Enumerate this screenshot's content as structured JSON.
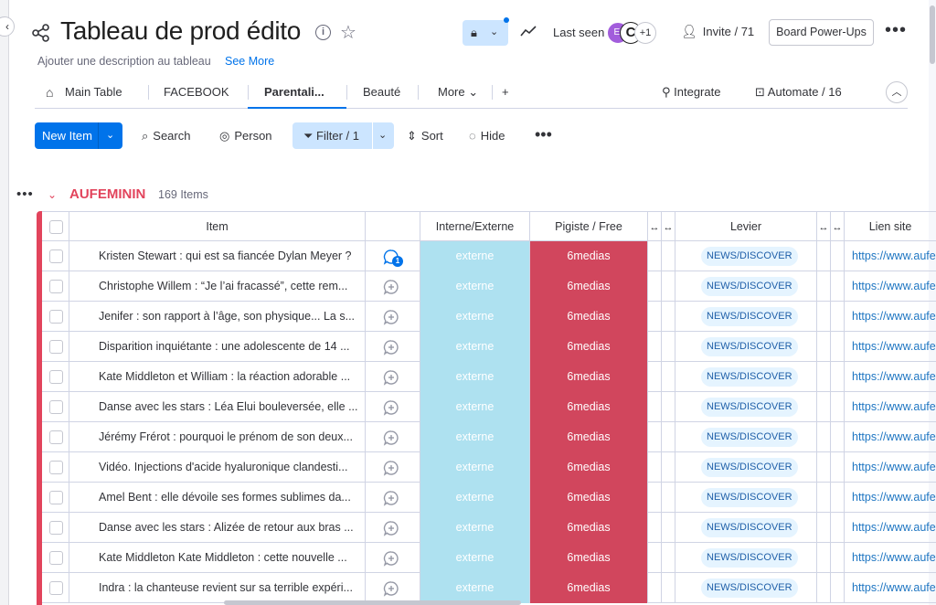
{
  "header": {
    "board_title": "Tableau de prod édito",
    "description_placeholder": "Ajouter une description au tableau",
    "see_more": "See More",
    "last_seen_label": "Last seen",
    "avatars": [
      {
        "initials": "El"
      },
      {
        "initials": "C"
      },
      {
        "initials": "+1"
      }
    ],
    "invite_label": "Invite / 71",
    "power_ups_label": "Board Power-Ups",
    "more_label": "•••",
    "accent_color": "#0073ea"
  },
  "views": {
    "tabs": [
      {
        "label": "Main Table"
      },
      {
        "label": "FACEBOOK"
      },
      {
        "label": "Parentali..."
      },
      {
        "label": "Beauté"
      }
    ],
    "more_label": "More",
    "add_label": "+",
    "integrate_label": "Integrate",
    "automate_label": "Automate / 16"
  },
  "toolbar": {
    "new_item_label": "New Item",
    "search_label": "Search",
    "person_label": "Person",
    "filter_label": "Filter / 1",
    "sort_label": "Sort",
    "hide_label": "Hide",
    "more_label": "•••"
  },
  "group": {
    "title": "AUFEMININ",
    "count": "169 Items",
    "color": "#e2445c"
  },
  "table": {
    "columns": {
      "item": "Item",
      "interne_externe": "Interne/Externe",
      "pigiste_free": "Pigiste / Free",
      "levier": "Levier",
      "lien_site": "Lien site"
    },
    "rows": [
      {
        "item": "Kristen Stewart : qui est sa fiancée Dylan Meyer ?",
        "updates": "1",
        "ie": "externe",
        "pigiste": "6medias",
        "levier": "NEWS/DISCOVER",
        "lien": "https://www.aufe"
      },
      {
        "item": "Christophe Willem : “Je l’ai fracassé”, cette rem...",
        "updates": "",
        "ie": "externe",
        "pigiste": "6medias",
        "levier": "NEWS/DISCOVER",
        "lien": "https://www.aufe"
      },
      {
        "item": "Jenifer : son rapport à l’âge, son physique... La s...",
        "updates": "",
        "ie": "externe",
        "pigiste": "6medias",
        "levier": "NEWS/DISCOVER",
        "lien": "https://www.aufe"
      },
      {
        "item": "Disparition inquiétante : une adolescente de 14 ...",
        "updates": "",
        "ie": "externe",
        "pigiste": "6medias",
        "levier": "NEWS/DISCOVER",
        "lien": "https://www.aufe"
      },
      {
        "item": "Kate Middleton et William : la réaction adorable ...",
        "updates": "",
        "ie": "externe",
        "pigiste": "6medias",
        "levier": "NEWS/DISCOVER",
        "lien": "https://www.aufe"
      },
      {
        "item": "Danse avec les stars : Léa Elui bouleversée, elle ...",
        "updates": "",
        "ie": "externe",
        "pigiste": "6medias",
        "levier": "NEWS/DISCOVER",
        "lien": "https://www.aufe"
      },
      {
        "item": "Jérémy Frérot : pourquoi le prénom de son deux...",
        "updates": "",
        "ie": "externe",
        "pigiste": "6medias",
        "levier": "NEWS/DISCOVER",
        "lien": "https://www.aufe"
      },
      {
        "item": "Vidéo. Injections d'acide hyaluronique clandesti...",
        "updates": "",
        "ie": "externe",
        "pigiste": "6medias",
        "levier": "NEWS/DISCOVER",
        "lien": "https://www.aufe"
      },
      {
        "item": "Amel Bent : elle dévoile ses formes sublimes da...",
        "updates": "",
        "ie": "externe",
        "pigiste": "6medias",
        "levier": "NEWS/DISCOVER",
        "lien": "https://www.aufe"
      },
      {
        "item": "Danse avec les stars : Alizée de retour aux bras ...",
        "updates": "",
        "ie": "externe",
        "pigiste": "6medias",
        "levier": "NEWS/DISCOVER",
        "lien": "https://www.aufe"
      },
      {
        "item": "Kate Middleton Kate Middleton : cette nouvelle ...",
        "updates": "",
        "ie": "externe",
        "pigiste": "6medias",
        "levier": "NEWS/DISCOVER",
        "lien": "https://www.aufe"
      },
      {
        "item": "Indra : la chanteuse revient sur sa terrible expéri...",
        "updates": "",
        "ie": "externe",
        "pigiste": "6medias",
        "levier": "NEWS/DISCOVER",
        "lien": "https://www.aufe"
      }
    ],
    "status_colors": {
      "externe": "#aee1f0",
      "6medias": "#d1465d"
    }
  }
}
